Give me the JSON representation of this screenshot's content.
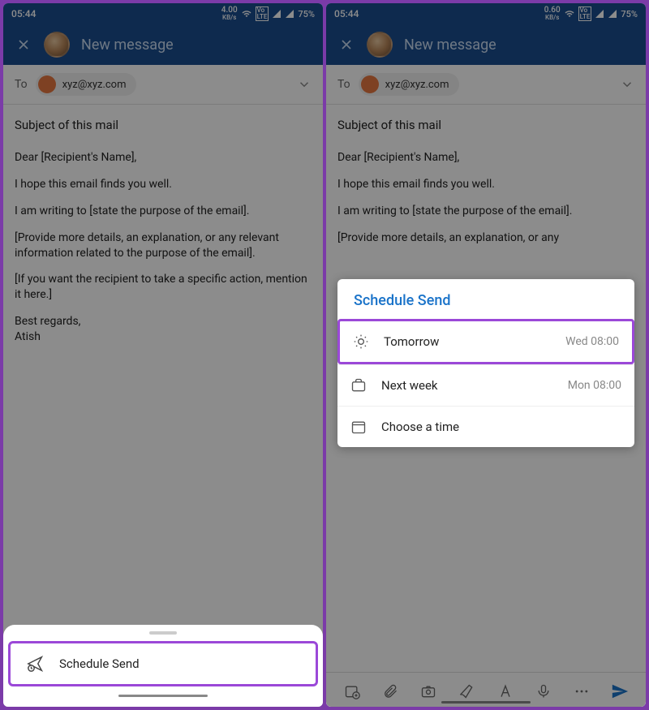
{
  "left": {
    "status": {
      "time": "05:44",
      "speed_num": "4.00",
      "speed_unit": "KB/s",
      "battery": "75%"
    },
    "header": {
      "title": "New message"
    },
    "to": {
      "label": "To",
      "chip": "xyz@xyz.com"
    },
    "subject": "Subject of this mail",
    "body": [
      "Dear [Recipient's Name],",
      "I hope this email finds you well.",
      "I am writing to [state the purpose of the email].",
      "[Provide more details, an explanation, or any relevant information related to the purpose of the email].",
      "[If you want the recipient to take a specific action, mention it here.]",
      "Best regards,\nAtish"
    ],
    "sheet": {
      "schedule": "Schedule Send"
    }
  },
  "right": {
    "status": {
      "time": "05:44",
      "speed_num": "0.60",
      "speed_unit": "KB/s",
      "battery": "75%"
    },
    "header": {
      "title": "New message"
    },
    "to": {
      "label": "To",
      "chip": "xyz@xyz.com"
    },
    "subject": "Subject of this mail",
    "body": [
      "Dear [Recipient's Name],",
      "I hope this email finds you well.",
      "I am writing to [state the purpose of the email].",
      "[Provide more details, an explanation, or any"
    ],
    "sheet": {
      "title": "Schedule Send",
      "options": [
        {
          "label": "Tomorrow",
          "time": "Wed 08:00"
        },
        {
          "label": "Next week",
          "time": "Mon 08:00"
        },
        {
          "label": "Choose a time",
          "time": ""
        }
      ]
    }
  }
}
